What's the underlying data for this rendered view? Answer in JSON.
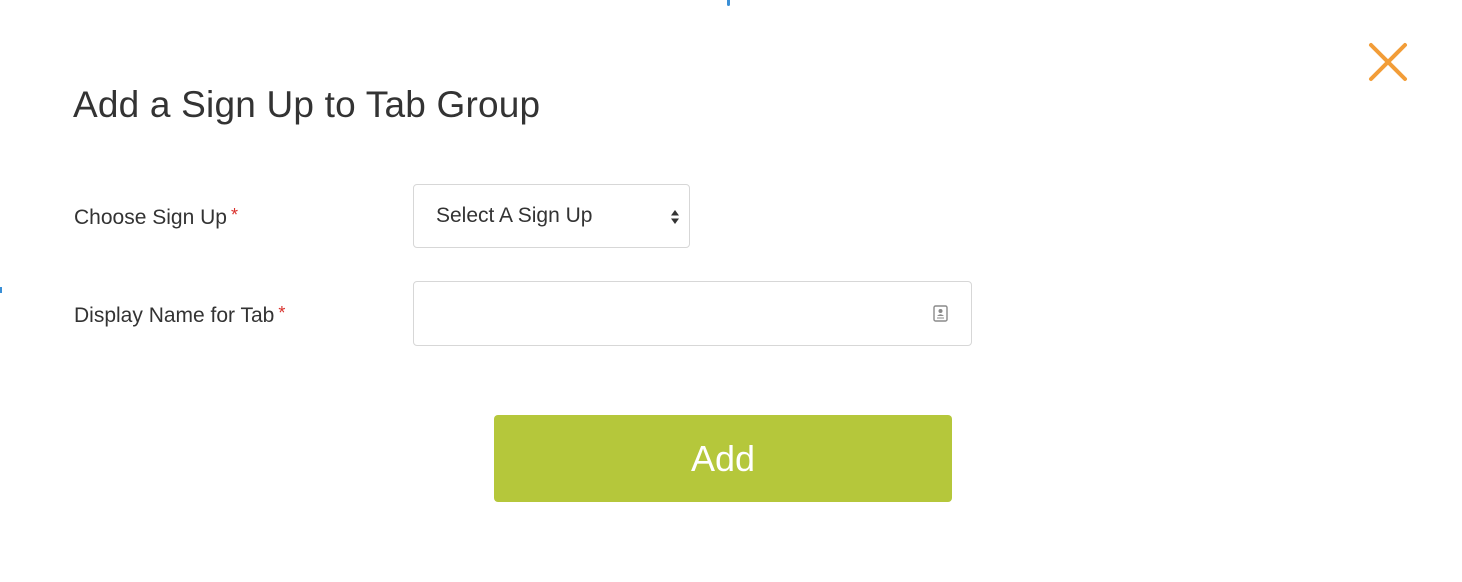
{
  "dialog": {
    "title": "Add a Sign Up to Tab Group",
    "close_icon": "close-x-icon",
    "close_color": "#f29d38"
  },
  "form": {
    "choose_signup": {
      "label": "Choose Sign Up",
      "required_mark": "*",
      "selected_value": "Select A Sign Up",
      "icon": "up-down-arrows-icon"
    },
    "display_name": {
      "label": "Display Name for Tab",
      "required_mark": "*",
      "value": "",
      "placeholder": "",
      "icon": "contact-card-icon"
    }
  },
  "actions": {
    "add_label": "Add",
    "add_color": "#b5c73b"
  },
  "colors": {
    "required": "#d9302b",
    "text": "#333333",
    "border": "#d7d7d7",
    "accent_blue": "#3a8fd6"
  }
}
